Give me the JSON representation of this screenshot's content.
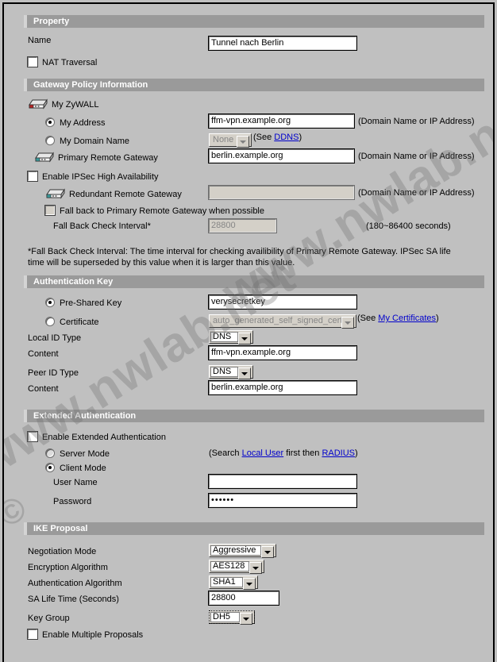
{
  "sections": {
    "property": {
      "title": "Property",
      "name_label": "Name",
      "name_value": "Tunnel nach Berlin",
      "nat_traversal_label": "NAT Traversal",
      "nat_traversal_checked": false
    },
    "gateway_policy": {
      "title": "Gateway Policy Information",
      "my_zywall_label": "My ZyWALL",
      "my_address_label": "My Address",
      "my_address_selected": true,
      "my_address_value": "ffm-vpn.example.org",
      "my_address_hint": "(Domain Name or IP Address)",
      "my_domain_name_label": "My Domain Name",
      "my_domain_name_selected": false,
      "ddns_select_value": "None",
      "ddns_prefix": "(See ",
      "ddns_link": "DDNS",
      "ddns_suffix": ")",
      "primary_remote_label": "Primary Remote Gateway",
      "primary_remote_value": "berlin.example.org",
      "primary_remote_hint": "(Domain Name or IP Address)",
      "enable_ha_label": "Enable IPSec High Availability",
      "enable_ha_checked": false,
      "redundant_label": "Redundant Remote Gateway",
      "redundant_value": "",
      "redundant_hint": "(Domain Name or IP Address)",
      "fallback_label": "Fall back to Primary Remote Gateway when possible",
      "fallback_checked": false,
      "fallback_interval_label": "Fall Back Check Interval*",
      "fallback_interval_value": "28800",
      "fallback_interval_hint": "(180~86400 seconds)",
      "footnote": "*Fall Back Check Interval: The time interval for checking availibility of Primary Remote Gateway. IPSec SA life time will be superseded by this value when it is larger than this value."
    },
    "authentication_key": {
      "title": "Authentication Key",
      "preshared_label": "Pre-Shared Key",
      "preshared_selected": true,
      "preshared_value": "verysecretkey",
      "certificate_label": "Certificate",
      "certificate_selected": false,
      "certificate_value": "auto_generated_self_signed_cert",
      "cert_prefix": "(See ",
      "cert_link": "My Certificates",
      "cert_suffix": ")",
      "local_id_type_label": "Local ID Type",
      "local_id_type_value": "DNS",
      "local_content_label": "Content",
      "local_content_value": "ffm-vpn.example.org",
      "peer_id_type_label": "Peer ID Type",
      "peer_id_type_value": "DNS",
      "peer_content_label": "Content",
      "peer_content_value": "berlin.example.org"
    },
    "extended_authentication": {
      "title": "Extended Authentication",
      "enable_label": "Enable Extended Authentication",
      "enable_checked": false,
      "server_mode_label": "Server Mode",
      "server_mode_selected": false,
      "search_prefix": "(Search ",
      "search_link1": "Local User",
      "search_middle": " first then ",
      "search_link2": "RADIUS",
      "search_suffix": ")",
      "client_mode_label": "Client Mode",
      "client_mode_selected": true,
      "username_label": "User Name",
      "username_value": "",
      "password_label": "Password",
      "password_value": "••••••"
    },
    "ike_proposal": {
      "title": "IKE Proposal",
      "negotiation_mode_label": "Negotiation Mode",
      "negotiation_mode_value": "Aggressive",
      "encryption_label": "Encryption Algorithm",
      "encryption_value": "AES128",
      "auth_algo_label": "Authentication Algorithm",
      "auth_algo_value": "SHA1",
      "sa_life_label": "SA Life Time (Seconds)",
      "sa_life_value": "28800",
      "key_group_label": "Key Group",
      "key_group_value": "DH5",
      "multiple_proposals_label": "Enable Multiple Proposals",
      "multiple_proposals_checked": false
    }
  },
  "watermark": {
    "text": "www.nwlab.net",
    "copyright": "©"
  },
  "colors": {
    "page_bg": "#c0c0c0",
    "section_header_bg": "#9a9a9a",
    "section_header_text": "#ffffff",
    "link": "#0000cc",
    "disabled_text": "#868686",
    "zywall_icon_accent": "#b22222",
    "remote_icon_accent": "#3a9a9a"
  }
}
